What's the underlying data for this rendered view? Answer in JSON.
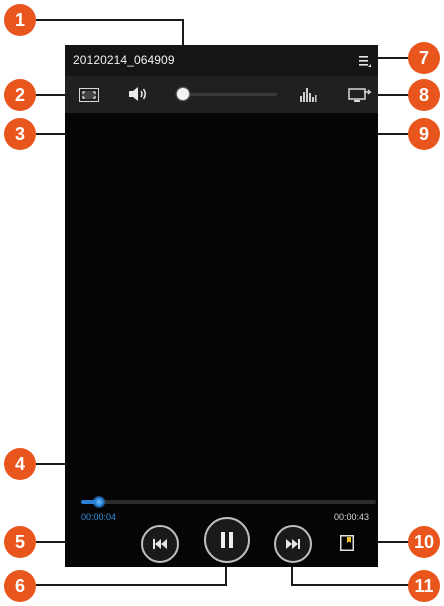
{
  "video": {
    "title": "20120214_064909",
    "elapsed": "00:00:04",
    "total": "00:00:43",
    "progress_fraction": 0.06,
    "volume_fraction": 0.0
  },
  "callouts": [
    "1",
    "2",
    "3",
    "4",
    "5",
    "6",
    "7",
    "8",
    "9",
    "10",
    "11"
  ],
  "colors": {
    "callout": "#e8561e",
    "seek_progress": "#2a7fd6",
    "screen_bg": "#050505"
  },
  "icons": {
    "menu": "menu-icon",
    "screen_mode": "fit-screen-icon",
    "volume": "speaker-icon",
    "sound_effects": "equalizer-icon",
    "share": "screen-mirror-icon",
    "previous": "skip-previous-icon",
    "pause": "pause-icon",
    "next": "skip-next-icon",
    "bookmark": "bookmark-icon"
  }
}
